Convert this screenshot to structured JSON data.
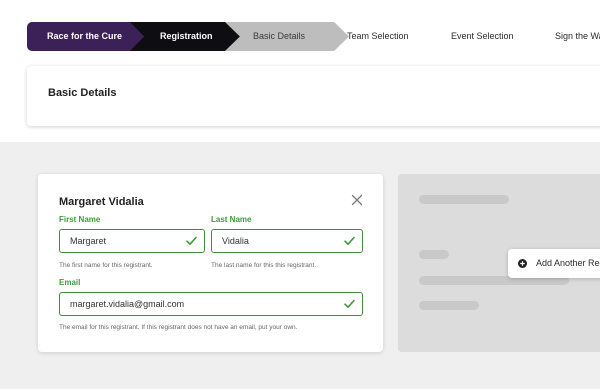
{
  "breadcrumb": {
    "steps": [
      {
        "label": "Race for the Cure"
      },
      {
        "label": "Registration"
      },
      {
        "label": "Basic Details"
      },
      {
        "label": "Team Selection"
      },
      {
        "label": "Event Selection"
      },
      {
        "label": "Sign the Wai"
      }
    ]
  },
  "header": {
    "title": "Basic Details"
  },
  "registrant": {
    "name": "Margaret Vidalia",
    "first_name": {
      "label": "First Name",
      "value": "Margaret",
      "hint": "The first name for this registrant."
    },
    "last_name": {
      "label": "Last Name",
      "value": "Vidalia",
      "hint": "The last name for this this registrant."
    },
    "email": {
      "label": "Email",
      "value": "margaret.vidalia@gmail.com",
      "hint": "The email for this registrant. If this registrant does not have an email, put your own."
    }
  },
  "add_registrant": {
    "label": "Add Another Regi"
  },
  "colors": {
    "step_active": "#3b2158",
    "step_current": "#0d0d12",
    "step_next": "#bdbdbd",
    "valid_green": "#3f8f37"
  },
  "icons": [
    "close-icon",
    "check-icon",
    "plus-circle-icon"
  ]
}
